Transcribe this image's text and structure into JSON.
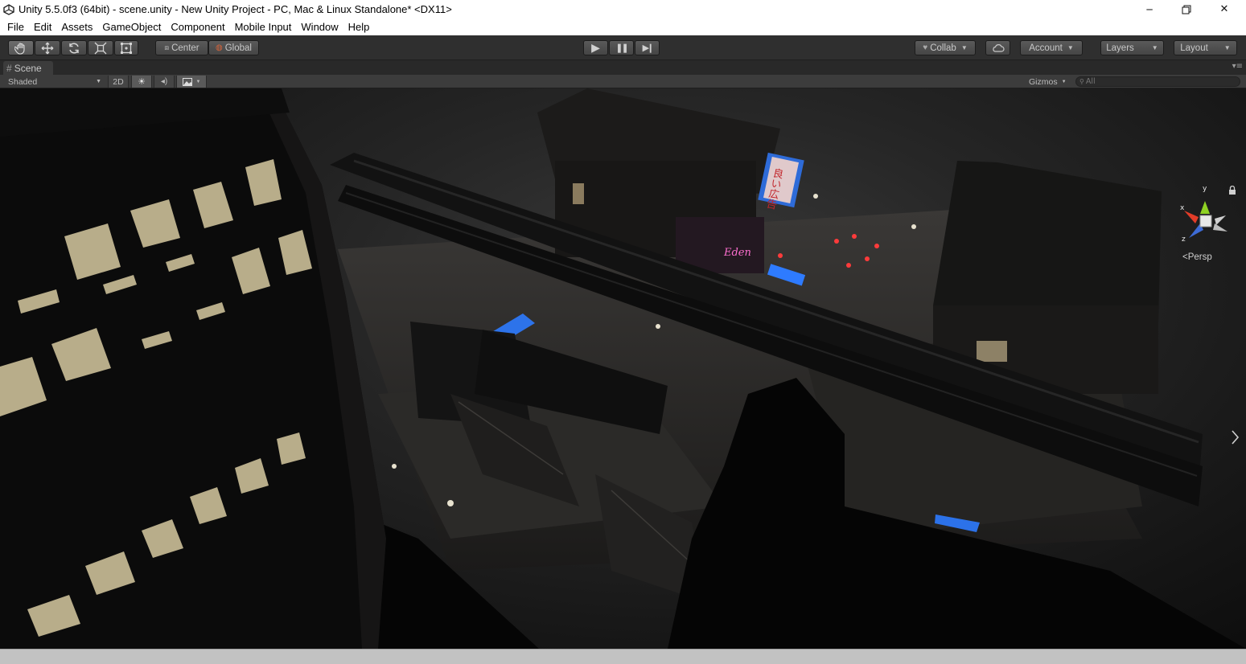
{
  "window": {
    "title": "Unity 5.5.0f3 (64bit) - scene.unity - New Unity Project - PC, Mac & Linux Standalone* <DX11>",
    "minimize_glyph": "─",
    "close_glyph": "✕"
  },
  "menu": [
    "File",
    "Edit",
    "Assets",
    "GameObject",
    "Component",
    "Mobile Input",
    "Window",
    "Help"
  ],
  "toolbar": {
    "pivot_label": "Center",
    "space_label": "Global",
    "collab_label": "Collab",
    "account_label": "Account",
    "layers_label": "Layers",
    "layout_label": "Layout",
    "play_glyph": "▶",
    "pause_glyph": "❚❚",
    "step_glyph": "▶❙"
  },
  "scene": {
    "tab_label": "Scene",
    "tab_icon": "#",
    "panel_menu_glyph": "▾≡",
    "shading_mode": "Shaded",
    "mode_2d_label": "2D",
    "gizmos_label": "Gizmos",
    "search_placeholder": "All",
    "projection_label": "Persp",
    "gizmo_axes": {
      "y": "y",
      "x": "x",
      "z": "z"
    },
    "billboard_texts": [
      "良い広告",
      "Eden"
    ]
  },
  "colors": {
    "titlebar": "#ffffff",
    "toolbar": "#2f2f2f",
    "panel": "#3c3c3c",
    "gizmo_x": "#e23c28",
    "gizmo_y": "#8fd123",
    "gizmo_z": "#3d6bd6",
    "neon_blue": "#2e7bff",
    "neon_pink": "#ff4fb8"
  }
}
